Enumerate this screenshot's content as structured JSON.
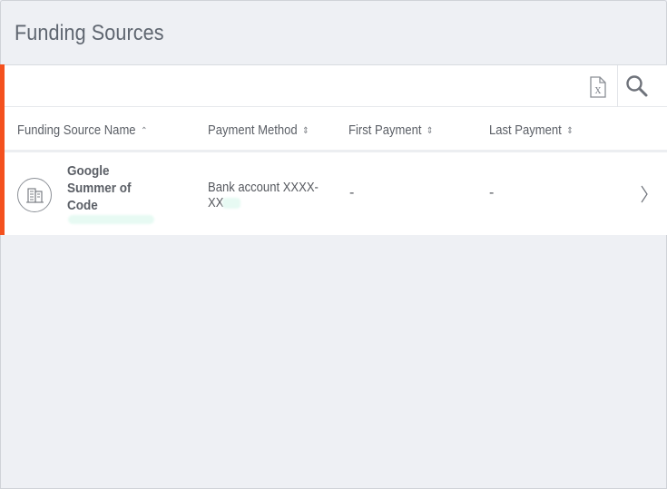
{
  "page": {
    "title": "Funding Sources"
  },
  "colors": {
    "accent": "#f4511e",
    "background": "#eef0f4",
    "panel": "#ffffff"
  },
  "toolbar": {
    "export_icon": "excel-export-icon",
    "search_icon": "search-icon"
  },
  "table": {
    "columns": [
      {
        "label": "Funding Source Name",
        "sort": "ascending"
      },
      {
        "label": "Payment Method",
        "sort": "none"
      },
      {
        "label": "First Payment",
        "sort": "none"
      },
      {
        "label": "Last Payment",
        "sort": "none"
      }
    ],
    "rows": [
      {
        "icon": "building-icon",
        "name": "Google Summer of Code",
        "payment_method": "Bank account XXXX-XX",
        "first_payment": "-",
        "last_payment": "-"
      }
    ]
  }
}
